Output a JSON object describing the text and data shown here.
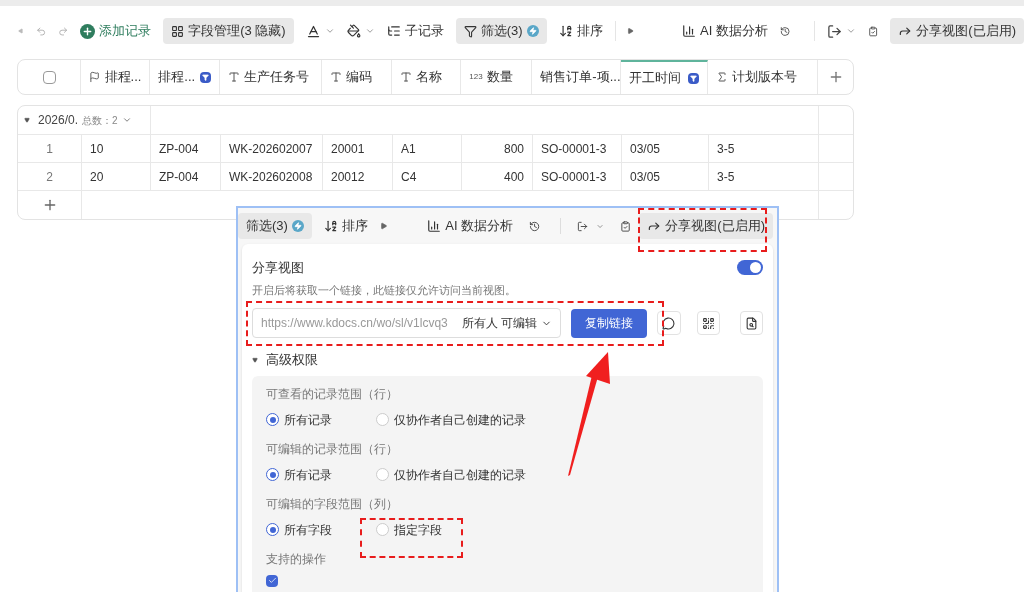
{
  "toolbar": {
    "add_record": "添加记录",
    "fields": {
      "label": "字段管理(3 隐藏)",
      "active": true
    },
    "subrecord": "子记录",
    "filter": {
      "label": "筛选(3)",
      "active": true
    },
    "sort": "排序",
    "ai": "AI 数据分析",
    "share": {
      "label": "分享视图(已启用)",
      "active": true
    }
  },
  "table": {
    "select_all": {
      "checked": false
    },
    "columns": [
      {
        "label": "排程...",
        "kind": "flag",
        "selected": false
      },
      {
        "label": "排程...",
        "kind": "badge",
        "selected": false
      },
      {
        "label": "生产任务号",
        "kind": "text",
        "selected": false
      },
      {
        "label": "编码",
        "kind": "text",
        "selected": false
      },
      {
        "label": "名称",
        "kind": "text",
        "selected": false
      },
      {
        "label": "数量",
        "kind": "number",
        "type_label": "123",
        "selected": false
      },
      {
        "label": "销售订单-项...",
        "kind": "plain",
        "selected": false
      },
      {
        "label": "开工时间",
        "kind": "badge",
        "selected": true
      },
      {
        "label": "计划版本号",
        "kind": "sigma",
        "selected": false
      }
    ],
    "group": {
      "label": "2026/0.",
      "count": "总数：2",
      "expanded": true
    },
    "rows": [
      {
        "index": "1",
        "cells": [
          "10",
          "ZP-004",
          "WK-202602007",
          "20001",
          "A1",
          "800",
          "SO-00001-3",
          "03/05",
          "3-5"
        ]
      },
      {
        "index": "2",
        "cells": [
          "20",
          "ZP-004",
          "WK-202602008",
          "20012",
          "C4",
          "400",
          "SO-00001-3",
          "03/05",
          "3-5"
        ]
      }
    ]
  },
  "share_panel": {
    "toolbar": {
      "filter": {
        "label": "筛选(3)",
        "active": true
      },
      "sort": "排序",
      "ai": "AI 数据分析",
      "share": {
        "label": "分享视图(已启用)",
        "active": true
      }
    },
    "title": "分享视图",
    "on": true,
    "description": "开启后将获取一个链接，此链接仅允许访问当前视图。",
    "link": "https://www.kdocs.cn/wo/sl/v1lcvq3",
    "permission": "所有人 可编辑",
    "copy_button": "复制链接",
    "advanced": {
      "label": "高级权限",
      "expanded": true
    },
    "sections": [
      {
        "title": "可查看的记录范围（行）",
        "options": [
          {
            "label": "所有记录",
            "selected": true
          },
          {
            "label": "仅协作者自己创建的记录",
            "selected": false
          }
        ]
      },
      {
        "title": "可编辑的记录范围（行）",
        "options": [
          {
            "label": "所有记录",
            "selected": true
          },
          {
            "label": "仅协作者自己创建的记录",
            "selected": false
          }
        ]
      },
      {
        "title": "可编辑的字段范围（列）",
        "options": [
          {
            "label": "所有字段",
            "selected": true
          },
          {
            "label": "指定字段",
            "selected": false
          }
        ]
      }
    ],
    "operations": {
      "title": "支持的操作",
      "checked": true
    }
  }
}
